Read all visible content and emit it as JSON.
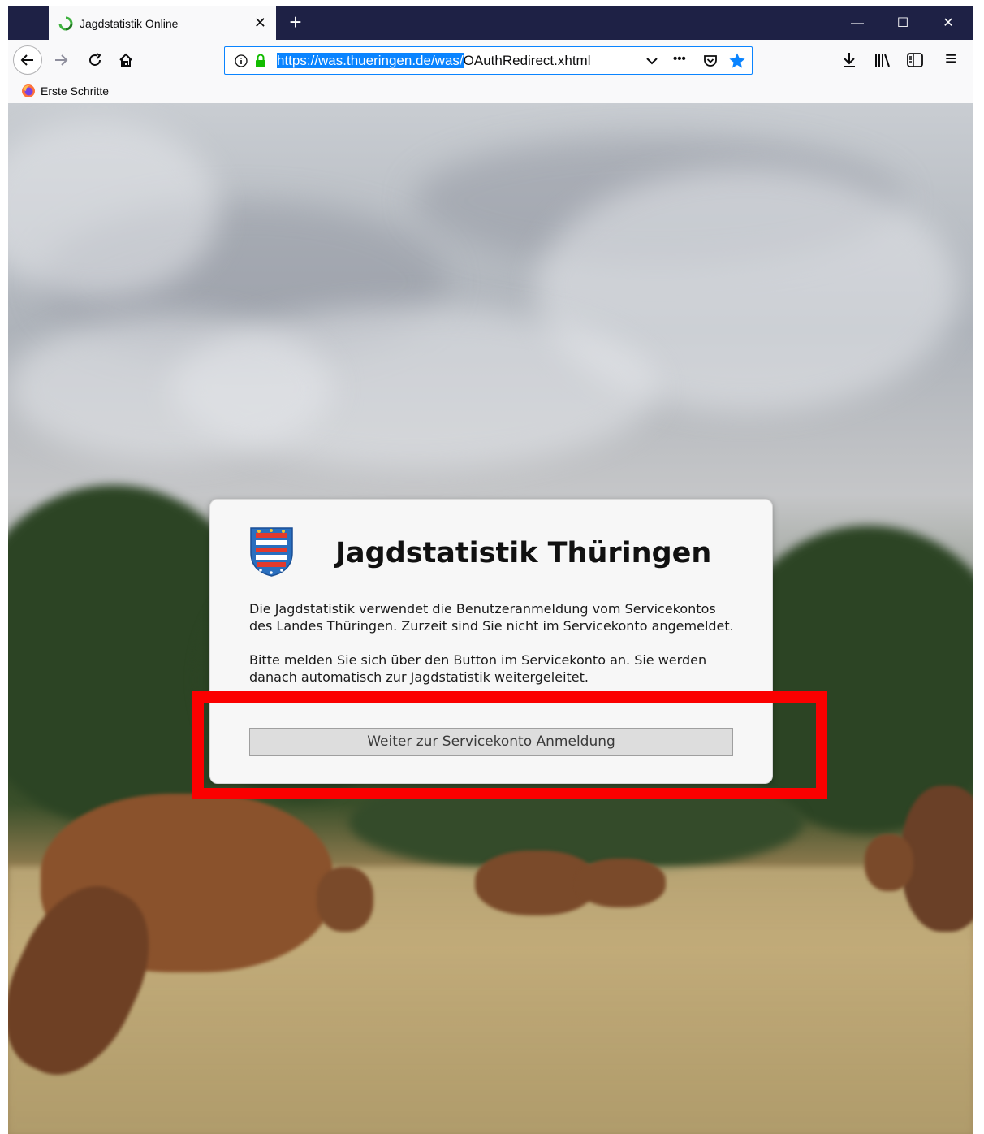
{
  "browser": {
    "tab_title": "Jagdstatistik Online",
    "tab_close_glyph": "✕",
    "new_tab_glyph": "+",
    "url_selected": "https://was.thueringen.de/was/",
    "url_rest": "OAuthRedirect.xhtml",
    "bookmark_label": "Erste Schritte",
    "window_controls": {
      "minimize": "—",
      "maximize": "☐",
      "close": "✕"
    },
    "page_actions_glyph": "•••",
    "menu_glyph": "≡"
  },
  "dialog": {
    "title": "Jagdstatistik Thüringen",
    "paragraph1": "Die Jagdstatistik verwendet die Benutzeranmeldung vom Servicekontos des Landes Thüringen. Zurzeit sind Sie nicht im Servicekonto angemeldet.",
    "paragraph2": "Bitte melden Sie sich über den Button im Servicekonto an. Sie werden danach automatisch zur Jagdstatistik weitergeleitet.",
    "button_label": "Weiter zur Servicekonto Anmeldung"
  },
  "colors": {
    "highlight": "#fb0000",
    "accent": "#0a84ff",
    "titlebar": "#1e2145"
  }
}
